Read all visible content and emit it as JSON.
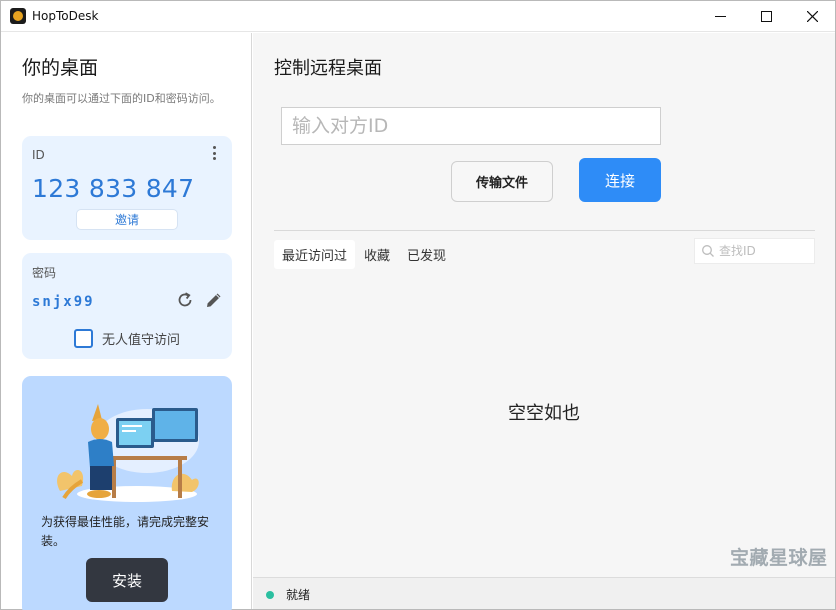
{
  "window": {
    "title": "HopToDesk",
    "controls": {
      "minimize": "minimize-icon",
      "maximize": "maximize-icon",
      "close": "close-icon"
    }
  },
  "sidebar": {
    "title": "你的桌面",
    "description": "你的桌面可以通过下面的ID和密码访问。",
    "id_card": {
      "label": "ID",
      "value": "123 833 847",
      "invite_label": "邀请",
      "menu_icon": "more-vertical-icon"
    },
    "password_card": {
      "label": "密码",
      "value": "snjx99",
      "refresh_icon": "refresh-icon",
      "edit_icon": "pencil-icon",
      "unattended_label": "无人值守访问",
      "unattended_checked": false
    },
    "install_card": {
      "text": "为获得最佳性能，请完成完整安装。",
      "button_label": "安装"
    }
  },
  "main": {
    "title": "控制远程桌面",
    "id_input": {
      "placeholder": "输入对方ID",
      "value": ""
    },
    "transfer_label": "传输文件",
    "connect_label": "连接",
    "tabs": [
      {
        "label": "最近访问过",
        "active": true
      },
      {
        "label": "收藏",
        "active": false
      },
      {
        "label": "已发现",
        "active": false
      }
    ],
    "search": {
      "placeholder": "查找ID"
    },
    "empty_text": "空空如也",
    "watermark": "宝藏星球屋"
  },
  "status": {
    "text": "就绪",
    "color": "#2bbfa0"
  },
  "colors": {
    "accent": "#2e8cf7",
    "id_text": "#2d79d6",
    "card_bg": "#e9f3ff",
    "install_bg": "#bcd9ff"
  }
}
